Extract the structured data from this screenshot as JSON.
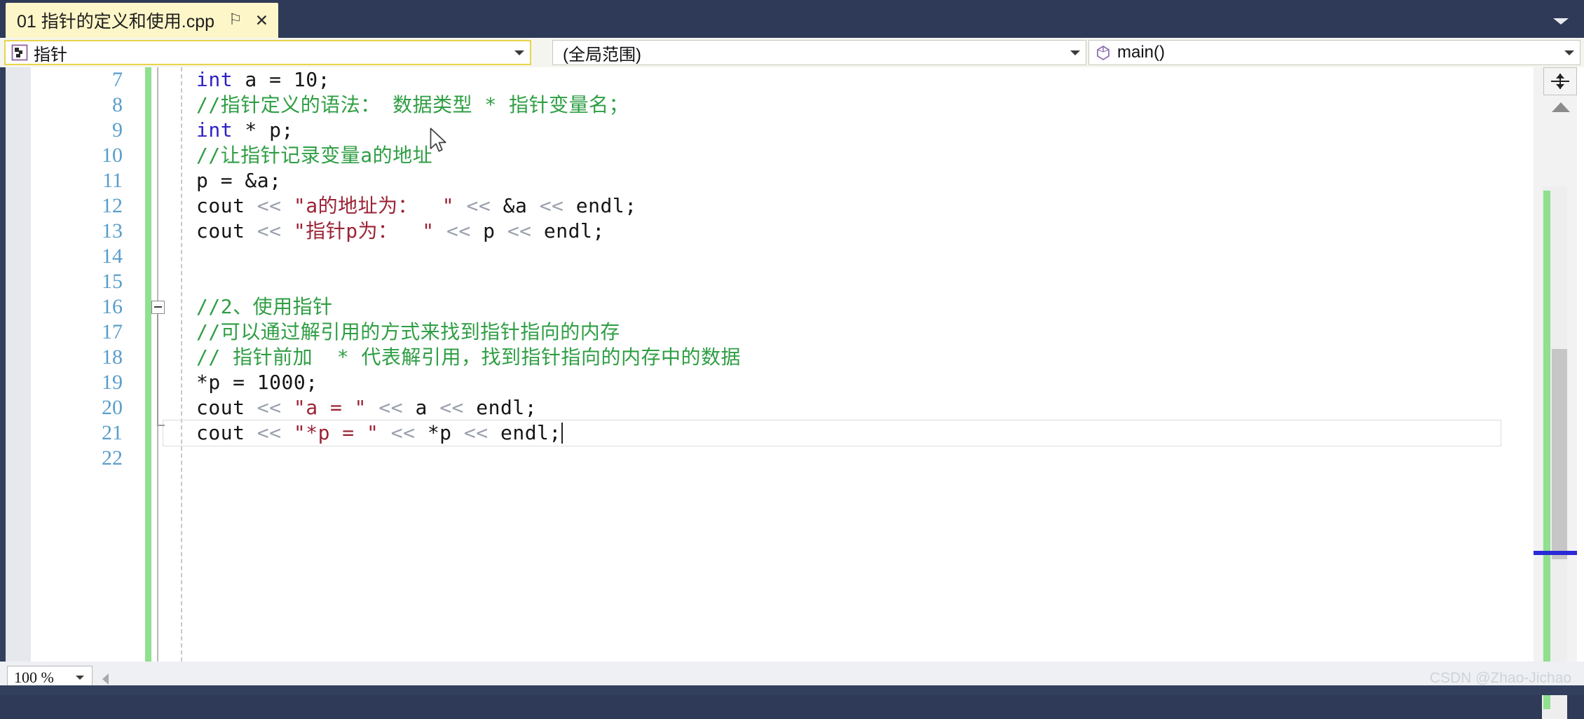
{
  "window": {
    "tab": {
      "title": "01 指针的定义和使用.cpp",
      "pin_icon": "⚐",
      "close_icon": "✕"
    },
    "tabstrip_overflow_icon": "chevron-down-icon"
  },
  "navbar": {
    "project_combo": {
      "icon": "project-icon",
      "value": "指针",
      "arrow": "▼"
    },
    "scope_combo": {
      "value": "(全局范围)",
      "arrow": "▼"
    },
    "member_combo": {
      "icon": "method-icon",
      "value": "main()",
      "arrow": "▼"
    }
  },
  "editor": {
    "current_line_number": 21,
    "fold_marker_line": 16,
    "lines": [
      {
        "no": "7",
        "tokens": [
          {
            "t": "kw",
            "s": "int"
          },
          {
            "t": "plain",
            "s": " a = 10;"
          }
        ]
      },
      {
        "no": "8",
        "tokens": [
          {
            "t": "com",
            "s": "//指针定义的语法： 数据类型 * 指针变量名；"
          }
        ]
      },
      {
        "no": "9",
        "tokens": [
          {
            "t": "kw",
            "s": "int"
          },
          {
            "t": "plain",
            "s": " * p;"
          }
        ]
      },
      {
        "no": "10",
        "tokens": [
          {
            "t": "com",
            "s": "//让指针记录变量a的地址"
          }
        ]
      },
      {
        "no": "11",
        "tokens": [
          {
            "t": "plain",
            "s": "p = &a;"
          }
        ]
      },
      {
        "no": "12",
        "tokens": [
          {
            "t": "plain",
            "s": "cout "
          },
          {
            "t": "op",
            "s": "<< "
          },
          {
            "t": "str",
            "s": "\"a的地址为：  \""
          },
          {
            "t": "op",
            "s": " << "
          },
          {
            "t": "plain",
            "s": "&a "
          },
          {
            "t": "op",
            "s": "<< "
          },
          {
            "t": "plain",
            "s": "endl;"
          }
        ]
      },
      {
        "no": "13",
        "tokens": [
          {
            "t": "plain",
            "s": "cout "
          },
          {
            "t": "op",
            "s": "<< "
          },
          {
            "t": "str",
            "s": "\"指针p为：  \""
          },
          {
            "t": "op",
            "s": " << "
          },
          {
            "t": "plain",
            "s": "p "
          },
          {
            "t": "op",
            "s": "<< "
          },
          {
            "t": "plain",
            "s": "endl;"
          }
        ]
      },
      {
        "no": "14",
        "tokens": []
      },
      {
        "no": "15",
        "tokens": []
      },
      {
        "no": "16",
        "tokens": [
          {
            "t": "com",
            "s": "//2、使用指针"
          }
        ]
      },
      {
        "no": "17",
        "tokens": [
          {
            "t": "com",
            "s": "//可以通过解引用的方式来找到指针指向的内存"
          }
        ]
      },
      {
        "no": "18",
        "tokens": [
          {
            "t": "com",
            "s": "// 指针前加  * 代表解引用，找到指针指向的内存中的数据"
          }
        ]
      },
      {
        "no": "19",
        "tokens": [
          {
            "t": "plain",
            "s": "*p = 1000;"
          }
        ]
      },
      {
        "no": "20",
        "tokens": [
          {
            "t": "plain",
            "s": "cout "
          },
          {
            "t": "op",
            "s": "<< "
          },
          {
            "t": "str",
            "s": "\"a = \""
          },
          {
            "t": "op",
            "s": " << "
          },
          {
            "t": "plain",
            "s": "a "
          },
          {
            "t": "op",
            "s": "<< "
          },
          {
            "t": "plain",
            "s": "endl;"
          }
        ]
      },
      {
        "no": "21",
        "tokens": [
          {
            "t": "plain",
            "s": "cout "
          },
          {
            "t": "op",
            "s": "<< "
          },
          {
            "t": "str",
            "s": "\"*p = \""
          },
          {
            "t": "op",
            "s": " << "
          },
          {
            "t": "plain",
            "s": "*p "
          },
          {
            "t": "op",
            "s": "<< "
          },
          {
            "t": "plain",
            "s": "endl;"
          }
        ],
        "caret": true
      },
      {
        "no": "22",
        "tokens": []
      }
    ]
  },
  "statusbar": {
    "zoom_level": "100 %",
    "zoom_arrow": "▼",
    "watermark": "CSDN @Zhao-Jichao"
  },
  "colors": {
    "chrome": "#32405e",
    "tab_active": "#fdf6c8",
    "combo_focus_border": "#e8d44a",
    "keyword": "#2f22c4",
    "comment": "#2f9e44",
    "string": "#9b2335",
    "operator": "#9aa0ad",
    "changebar_green": "#8fe08f",
    "caret_marker_blue": "#2a2ad6",
    "lineno": "#5a9ecb"
  }
}
